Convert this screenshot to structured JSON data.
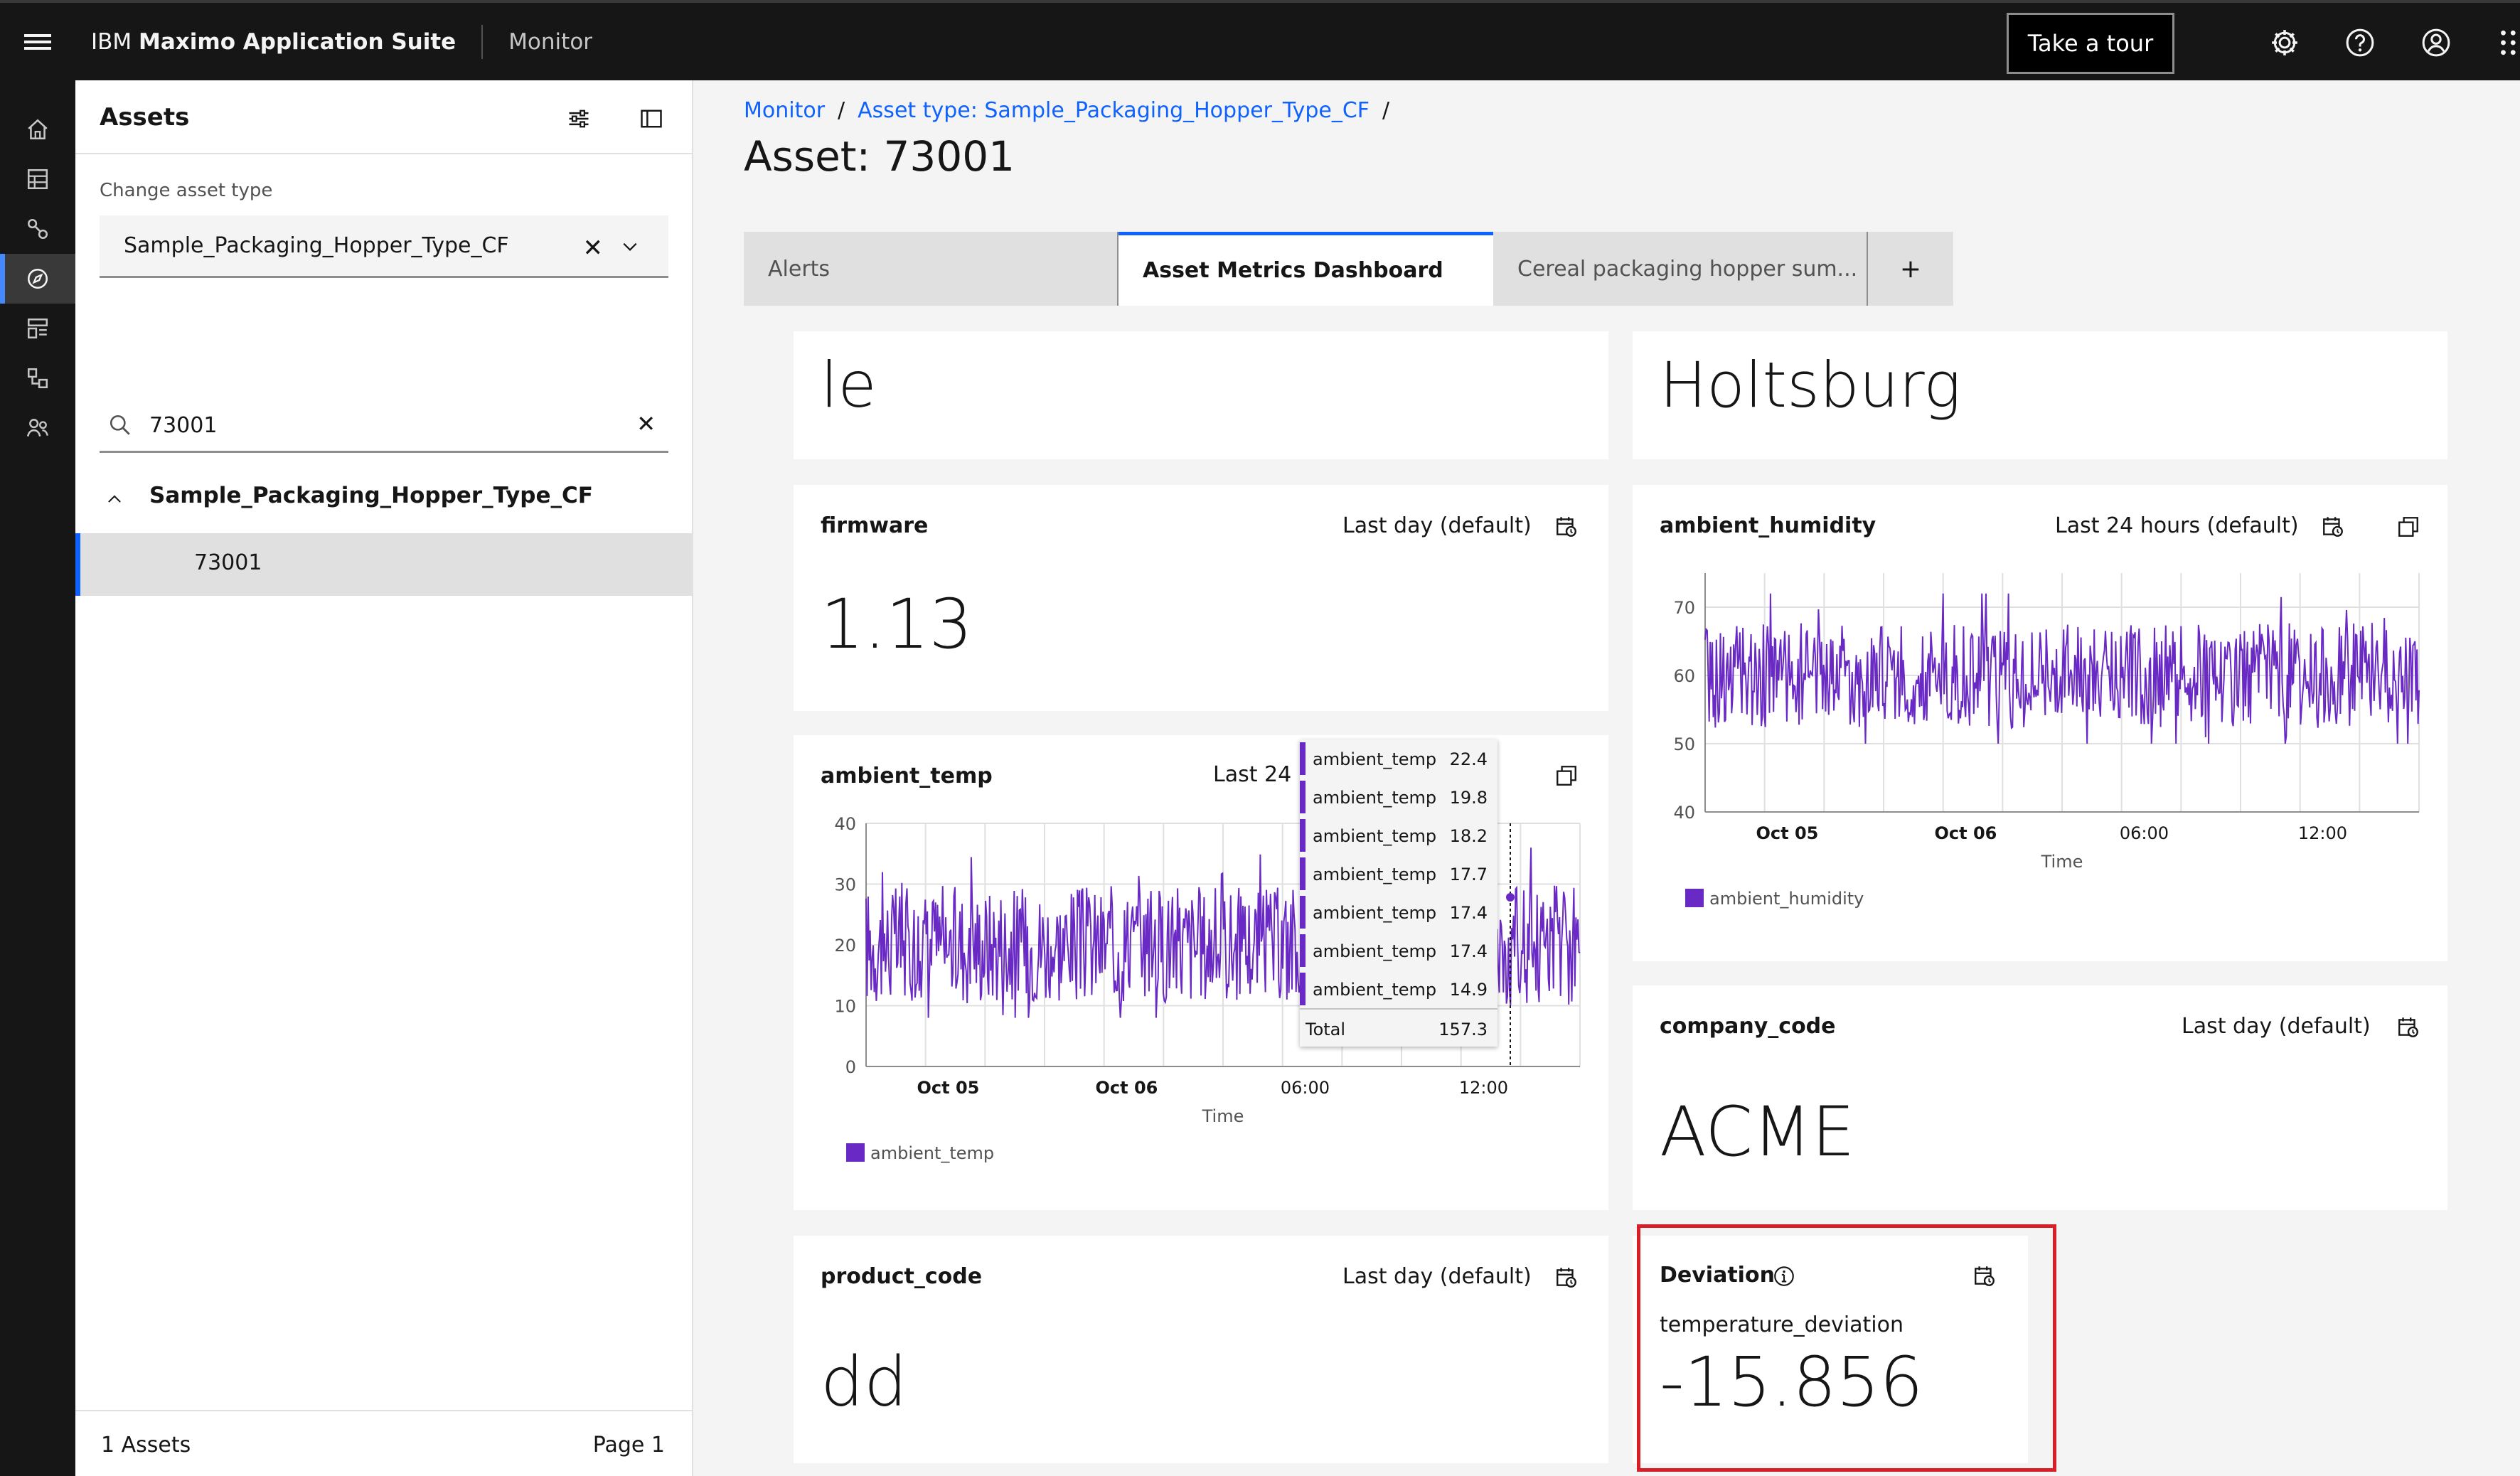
{
  "header": {
    "brand_light": "IBM ",
    "brand_bold": "Maximo Application Suite",
    "product": "Monitor",
    "tour_label": "Take a tour"
  },
  "assets_panel": {
    "title": "Assets",
    "change_label": "Change asset type",
    "asset_type": "Sample_Packaging_Hopper_Type_CF",
    "search_value": "73001",
    "group_label": "Sample_Packaging_Hopper_Type_CF",
    "selected_asset": "73001",
    "count": "1 Assets",
    "page": "Page 1"
  },
  "breadcrumb": {
    "root": "Monitor",
    "asset_type": "Asset type: Sample_Packaging_Hopper_Type_CF",
    "sep": "/"
  },
  "page_title": "Asset: 73001",
  "tabs": [
    {
      "label": "Alerts"
    },
    {
      "label": "Asset Metrics Dashboard"
    },
    {
      "label": "Cereal packaging hopper sum..."
    },
    {
      "label": "+"
    }
  ],
  "cards": {
    "top_left": {
      "value": "le"
    },
    "top_right": {
      "value": "Holtsburg"
    },
    "firmware": {
      "title": "firmware",
      "range": "Last day (default)",
      "value": "1.13"
    },
    "ambient_humidity": {
      "title": "ambient_humidity",
      "range": "Last 24 hours (default)"
    },
    "ambient_temp": {
      "title": "ambient_temp",
      "range": "Last 24 h"
    },
    "company_code": {
      "title": "company_code",
      "range": "Last day (default)",
      "value": "ACME"
    },
    "product_code": {
      "title": "product_code",
      "range": "Last day (default)",
      "value": "dd"
    },
    "deviation": {
      "title": "Deviation",
      "metric": "temperature_deviation",
      "value": "-15.856"
    }
  },
  "tooltip": {
    "rows": [
      {
        "name": "ambient_temp",
        "value": "22.4"
      },
      {
        "name": "ambient_temp",
        "value": "19.8"
      },
      {
        "name": "ambient_temp",
        "value": "18.2"
      },
      {
        "name": "ambient_temp",
        "value": "17.7"
      },
      {
        "name": "ambient_temp",
        "value": "17.4"
      },
      {
        "name": "ambient_temp",
        "value": "17.4"
      },
      {
        "name": "ambient_temp",
        "value": "14.9"
      }
    ],
    "total_label": "Total",
    "total_value": "157.3"
  },
  "colors": {
    "series": "#6929c4",
    "accent": "#0f62fe",
    "highlight": "#da1e28"
  },
  "chart_data": [
    {
      "type": "line",
      "name": "ambient_temp",
      "xlabel": "Time",
      "ylabel": "",
      "yticks": [
        "40",
        "30",
        "20",
        "10",
        "0"
      ],
      "ylim": [
        0,
        40
      ],
      "xticks": [
        "Oct 05",
        "Oct 06",
        "06:00",
        "12:00"
      ],
      "series": [
        {
          "name": "ambient_temp",
          "mean": 20,
          "range": [
            8,
            36
          ]
        }
      ],
      "legend": "bottom-left",
      "legend_label": "ambient_temp"
    },
    {
      "type": "line",
      "name": "ambient_humidity",
      "xlabel": "Time",
      "ylabel": "",
      "yticks": [
        "70",
        "60",
        "50",
        "40"
      ],
      "ylim": [
        40,
        75
      ],
      "xticks": [
        "Oct 05",
        "Oct 06",
        "06:00",
        "12:00"
      ],
      "series": [
        {
          "name": "ambient_humidity",
          "mean": 60,
          "range": [
            50,
            72
          ]
        }
      ],
      "legend": "bottom-left",
      "legend_label": "ambient_humidity"
    }
  ]
}
